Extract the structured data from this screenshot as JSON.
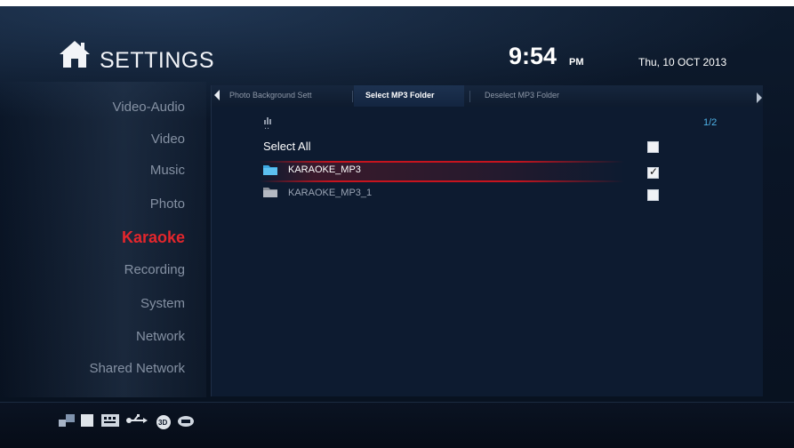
{
  "header": {
    "title": "SETTINGS",
    "time": "9:54",
    "ampm": "PM",
    "date": "Thu, 10 OCT 2013"
  },
  "sidebar": {
    "items": [
      {
        "label": "Video-Audio"
      },
      {
        "label": "Video"
      },
      {
        "label": "Music"
      },
      {
        "label": "Photo"
      },
      {
        "label": "Karaoke",
        "active": true
      },
      {
        "label": "Recording"
      },
      {
        "label": "System"
      },
      {
        "label": "Network"
      },
      {
        "label": "Shared Network"
      }
    ]
  },
  "tabs": {
    "items": [
      {
        "label": "Photo Background Sett"
      },
      {
        "label": "Select MP3 Folder",
        "active": true
      },
      {
        "label": "Deselect MP3 Folder"
      }
    ]
  },
  "file_list": {
    "up_label": "..",
    "select_all_label": "Select All",
    "page_indicator": "1/2",
    "folders": [
      {
        "name": "KARAOKE_MP3",
        "checked": true,
        "selected": true
      },
      {
        "name": "KARAOKE_MP3_1",
        "checked": false,
        "selected": false
      }
    ]
  },
  "footer": {
    "icons": [
      "network-icon",
      "card-icon",
      "sd-card-icon",
      "usb-icon",
      "3d-icon",
      "hdd-icon"
    ]
  },
  "colors": {
    "accent_red": "#e3262c",
    "page_indicator": "#4fb3e8",
    "background": "#0a1526"
  }
}
